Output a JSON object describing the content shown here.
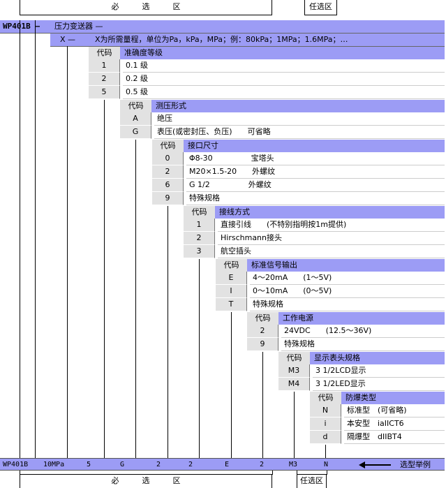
{
  "top_labels": {
    "required": "必　　　选　　　区",
    "optional": "任选区"
  },
  "model": {
    "code": "WP401B —",
    "title": "压力变送器 —"
  },
  "range_row": {
    "code": "X —",
    "text": "X为所需量程，单位为Pa，kPa，MPa；例：80kPa；1MPa；1.6MPa；…"
  },
  "sections": {
    "accuracy": {
      "code_header": "代码",
      "title": "准确度等级",
      "rows": [
        {
          "code": "1",
          "desc": "0.1 级"
        },
        {
          "code": "2",
          "desc": "0.2 级"
        },
        {
          "code": "5",
          "desc": "0.5 级"
        }
      ]
    },
    "pressure": {
      "code_header": "代码",
      "title": "测压形式",
      "rows": [
        {
          "code": "A",
          "desc": "绝压"
        },
        {
          "code": "G",
          "desc": "表压(或密封压、负压)　　可省略"
        }
      ]
    },
    "port": {
      "code_header": "代码",
      "title": "接口尺寸",
      "rows": [
        {
          "code": "0",
          "desc": "Φ8-30　　　　　宝塔头"
        },
        {
          "code": "2",
          "desc": "M20×1.5-20　　外螺纹"
        },
        {
          "code": "6",
          "desc": "G 1/2　　　　　外螺纹"
        },
        {
          "code": "9",
          "desc": "特殊规格"
        }
      ]
    },
    "wiring": {
      "code_header": "代码",
      "title": "接线方式",
      "rows": [
        {
          "code": "1",
          "desc": "直接引线　　(不特别指明按1m提供)"
        },
        {
          "code": "2",
          "desc": "Hirschmann接头"
        },
        {
          "code": "3",
          "desc": "航空插头"
        }
      ]
    },
    "signal": {
      "code_header": "代码",
      "title": "标准信号输出",
      "rows": [
        {
          "code": "E",
          "desc": "4～20mA　　(1～5V)"
        },
        {
          "code": "I",
          "desc": "0～10mA　　(0～5V)"
        },
        {
          "code": "T",
          "desc": "特殊规格"
        }
      ]
    },
    "power": {
      "code_header": "代码",
      "title": "工作电源",
      "rows": [
        {
          "code": "2",
          "desc": "24VDC　　(12.5～36V)"
        },
        {
          "code": "9",
          "desc": "特殊规格"
        }
      ]
    },
    "display": {
      "code_header": "代码",
      "title": "显示表头规格",
      "rows": [
        {
          "code": "M3",
          "desc": "3 1/2LCD显示"
        },
        {
          "code": "M4",
          "desc": "3 1/2LED显示"
        }
      ]
    },
    "explosion": {
      "code_header": "代码",
      "title": "防爆类型",
      "rows": [
        {
          "code": "N",
          "desc": "标准型　(可省略)"
        },
        {
          "code": "i",
          "desc": "本安型　iaIICT6"
        },
        {
          "code": "d",
          "desc": "隔爆型　dIIBT4"
        }
      ]
    }
  },
  "example": {
    "values": [
      "WP401B",
      "10MPa",
      "5",
      "G",
      "2",
      "2",
      "E",
      "2",
      "M3",
      "N"
    ],
    "arrow_label": "选型举例"
  },
  "bottom_labels": {
    "required": "必　　　选　　　区",
    "optional": "任选区"
  }
}
